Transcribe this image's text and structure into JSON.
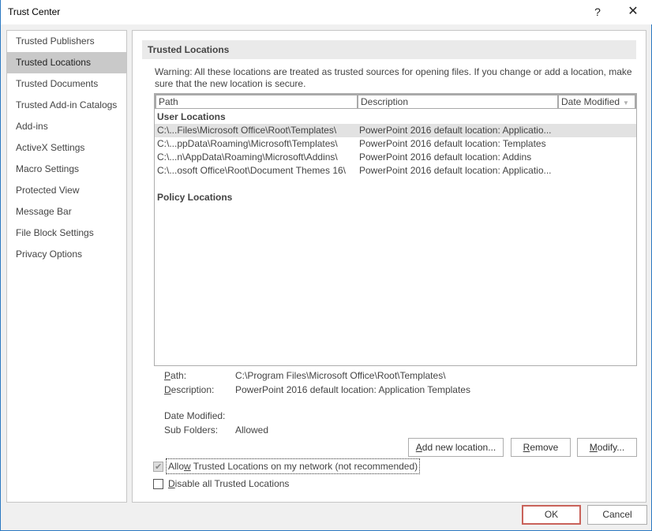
{
  "window": {
    "title": "Trust Center",
    "help_label": "?",
    "close_label": "✕"
  },
  "sidebar": {
    "items": [
      {
        "label": "Trusted Publishers",
        "selected": false
      },
      {
        "label": "Trusted Locations",
        "selected": true
      },
      {
        "label": "Trusted Documents",
        "selected": false
      },
      {
        "label": "Trusted Add-in Catalogs",
        "selected": false
      },
      {
        "label": "Add-ins",
        "selected": false
      },
      {
        "label": "ActiveX Settings",
        "selected": false
      },
      {
        "label": "Macro Settings",
        "selected": false
      },
      {
        "label": "Protected View",
        "selected": false
      },
      {
        "label": "Message Bar",
        "selected": false
      },
      {
        "label": "File Block Settings",
        "selected": false
      },
      {
        "label": "Privacy Options",
        "selected": false
      }
    ]
  },
  "main": {
    "section_title": "Trusted Locations",
    "warning": "Warning: All these locations are treated as trusted sources for opening files.  If you change or add a location, make sure that the new location is secure.",
    "columns": {
      "path": "Path",
      "description": "Description",
      "date_modified": "Date Modified",
      "sort_icon": "▼"
    },
    "user_locations_title": "User Locations",
    "user_locations": [
      {
        "path": "C:\\...Files\\Microsoft Office\\Root\\Templates\\",
        "description": "PowerPoint 2016 default location: Applicatio...",
        "selected": true
      },
      {
        "path": "C:\\...ppData\\Roaming\\Microsoft\\Templates\\",
        "description": "PowerPoint 2016 default location: Templates",
        "selected": false
      },
      {
        "path": "C:\\...n\\AppData\\Roaming\\Microsoft\\Addins\\",
        "description": "PowerPoint 2016 default location: Addins",
        "selected": false
      },
      {
        "path": "C:\\...osoft Office\\Root\\Document Themes 16\\",
        "description": "PowerPoint 2016 default location: Applicatio...",
        "selected": false
      }
    ],
    "policy_locations_title": "Policy Locations",
    "details": {
      "path_label_u": "P",
      "path_label_rest": "ath:",
      "path_value": "C:\\Program Files\\Microsoft Office\\Root\\Templates\\",
      "description_label_u": "D",
      "description_label_rest": "escription:",
      "description_value": "PowerPoint 2016 default location: Application Templates",
      "date_modified_label": "Date Modified:",
      "date_modified_value": "",
      "sub_folders_label": "Sub Folders:",
      "sub_folders_value": "Allowed"
    },
    "buttons": {
      "add_u": "A",
      "add_rest": "dd new location...",
      "remove_u": "R",
      "remove_rest": "emove",
      "modify_u": "M",
      "modify_rest": "odify..."
    },
    "checkboxes": {
      "allow_network": {
        "label_pre": "Allo",
        "label_u": "w",
        "label_post": " Trusted Locations on my network (not recommended)",
        "checked": true,
        "disabled": true
      },
      "disable_all": {
        "label_u": "D",
        "label_post": "isable all Trusted Locations",
        "checked": false
      }
    }
  },
  "footer": {
    "ok_label": "OK",
    "cancel_label": "Cancel"
  }
}
